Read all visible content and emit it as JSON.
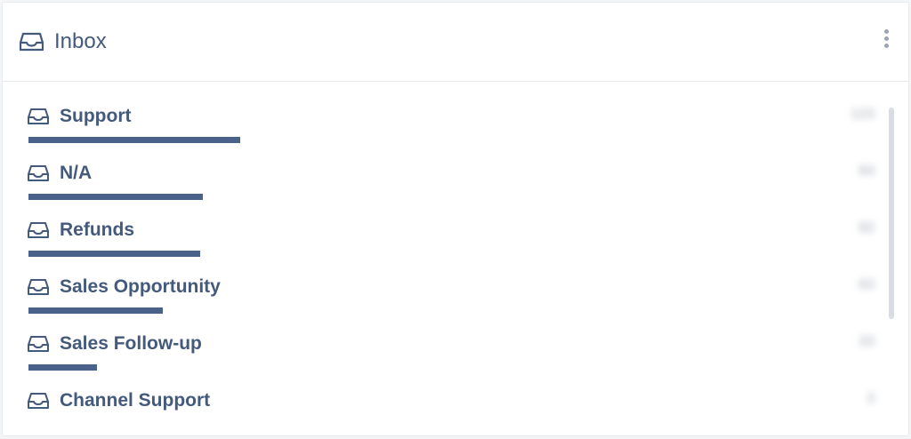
{
  "header": {
    "title": "Inbox",
    "icon": "inbox-icon",
    "menu_icon": "more-vertical-icon"
  },
  "colors": {
    "text": "#445a7c",
    "bar": "#4a6189"
  },
  "inbox_items": [
    {
      "label": "Support",
      "count": "123",
      "bar_fraction": 1.0
    },
    {
      "label": "N/A",
      "count": "84",
      "bar_fraction": 0.823
    },
    {
      "label": "Refunds",
      "count": "82",
      "bar_fraction": 0.81
    },
    {
      "label": "Sales Opportunity",
      "count": "63",
      "bar_fraction": 0.634
    },
    {
      "label": "Sales Follow-up",
      "count": "33",
      "bar_fraction": 0.324
    },
    {
      "label": "Channel Support",
      "count": "3",
      "bar_fraction": 0.0
    }
  ]
}
